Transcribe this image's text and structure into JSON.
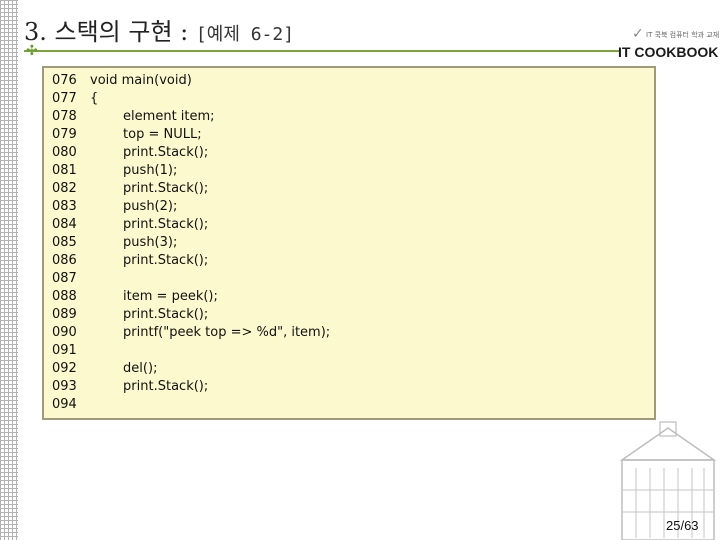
{
  "title": {
    "main": "3. 스택의 구현 :",
    "sub": "[예제 6-2]"
  },
  "logo": {
    "small_text": "IT 쿡북 컴퓨터 학과 교재",
    "brand": "IT COOKBOOK"
  },
  "code_lines": [
    {
      "no": "076",
      "text": "void main(void)"
    },
    {
      "no": "077",
      "text": "{"
    },
    {
      "no": "078",
      "text": "        element item;"
    },
    {
      "no": "079",
      "text": "        top = NULL;"
    },
    {
      "no": "080",
      "text": "        print.Stack();"
    },
    {
      "no": "081",
      "text": "        push(1);"
    },
    {
      "no": "082",
      "text": "        print.Stack();"
    },
    {
      "no": "083",
      "text": "        push(2);"
    },
    {
      "no": "084",
      "text": "        print.Stack();"
    },
    {
      "no": "085",
      "text": "        push(3);"
    },
    {
      "no": "086",
      "text": "        print.Stack();"
    },
    {
      "no": "087",
      "text": ""
    },
    {
      "no": "088",
      "text": "        item = peek();"
    },
    {
      "no": "089",
      "text": "        print.Stack();"
    },
    {
      "no": "090",
      "text": "        printf(\"peek top => %d\", item);"
    },
    {
      "no": "091",
      "text": ""
    },
    {
      "no": "092",
      "text": "        del();"
    },
    {
      "no": "093",
      "text": "        print.Stack();"
    },
    {
      "no": "094",
      "text": ""
    }
  ],
  "page_number": "25/63",
  "colors": {
    "accent": "#7aa63a",
    "code_bg": "#fdf9cf",
    "code_border": "#a09a7a"
  }
}
